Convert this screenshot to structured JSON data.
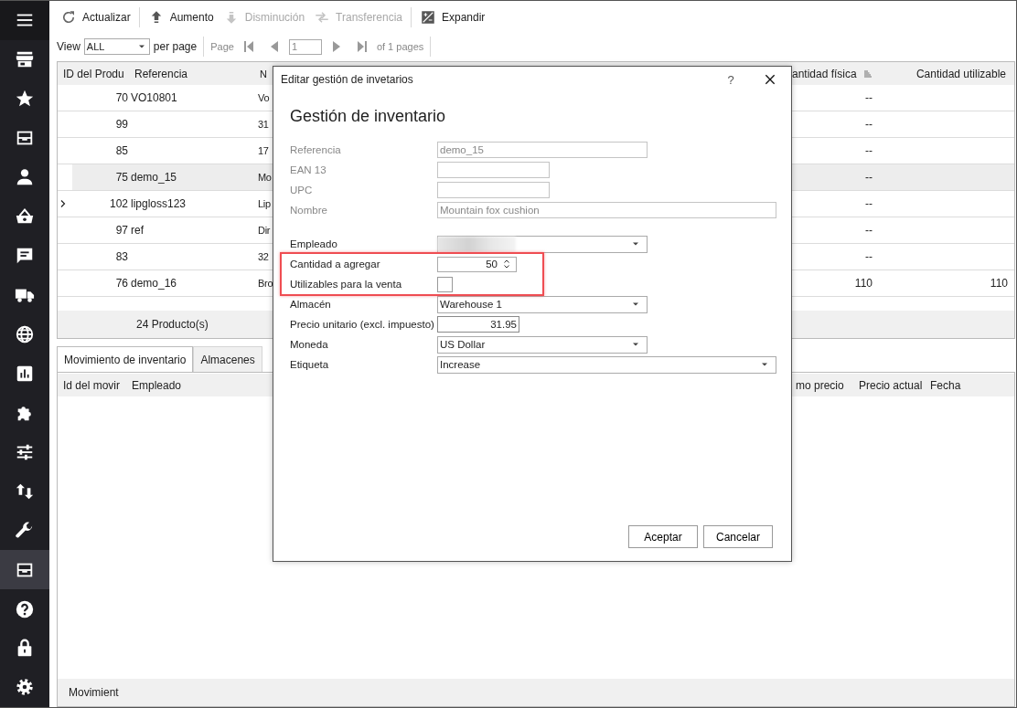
{
  "sidebar": {
    "items": [
      {
        "kind": "menu",
        "selected": false
      },
      {
        "kind": "store",
        "selected": false
      },
      {
        "kind": "star",
        "selected": false
      },
      {
        "kind": "archive",
        "selected": false
      },
      {
        "kind": "user",
        "selected": false
      },
      {
        "kind": "basket",
        "selected": false
      },
      {
        "kind": "chat",
        "selected": false
      },
      {
        "kind": "truck",
        "selected": false
      },
      {
        "kind": "globe",
        "selected": false
      },
      {
        "kind": "chart",
        "selected": false
      },
      {
        "kind": "puzzle",
        "selected": false
      },
      {
        "kind": "sliders",
        "selected": false
      },
      {
        "kind": "swap",
        "selected": false
      },
      {
        "kind": "wrench",
        "selected": false
      },
      {
        "kind": "archive",
        "selected": true
      },
      {
        "kind": "help",
        "selected": false
      },
      {
        "kind": "lock",
        "selected": false
      },
      {
        "kind": "gear",
        "selected": false
      }
    ]
  },
  "toolbar": {
    "buttons": [
      {
        "kind": "refresh",
        "label": "Actualizar",
        "disabled": false
      },
      {
        "kind": "up",
        "label": "Aumento",
        "disabled": false
      },
      {
        "kind": "down",
        "label": "Disminución",
        "disabled": true
      },
      {
        "kind": "transfer",
        "label": "Transferencia",
        "disabled": true
      },
      {
        "kind": "expand",
        "label": "Expandir",
        "disabled": false
      }
    ]
  },
  "pager": {
    "view_label": "View",
    "per_page_value": "ALL",
    "per_page_label": "per page",
    "page_label": "Page",
    "page_value": "1",
    "total_label": "of 1 pages"
  },
  "products_table": {
    "columns": [
      "ID del Produ",
      "Referencia",
      "N",
      "antidad física",
      "Cantidad utilizable"
    ],
    "rows": [
      {
        "id": "70",
        "reference": "VO10801",
        "column_3": "Vo",
        "physical": "--",
        "usable": "",
        "selected": false,
        "current": false
      },
      {
        "id": "99",
        "reference": "",
        "column_3": "31",
        "physical": "--",
        "usable": "",
        "selected": false,
        "current": false
      },
      {
        "id": "85",
        "reference": "",
        "column_3": "17",
        "physical": "--",
        "usable": "",
        "selected": false,
        "current": false
      },
      {
        "id": "75",
        "reference": "demo_15",
        "column_3": "Mo",
        "physical": "--",
        "usable": "",
        "selected": true,
        "current": false
      },
      {
        "id": "102",
        "reference": "lipgloss123",
        "column_3": "Lip",
        "physical": "--",
        "usable": "",
        "selected": false,
        "current": true
      },
      {
        "id": "97",
        "reference": "ref",
        "column_3": "Dir",
        "physical": "--",
        "usable": "",
        "selected": false,
        "current": false
      },
      {
        "id": "83",
        "reference": "",
        "column_3": "32",
        "physical": "--",
        "usable": "",
        "selected": false,
        "current": false
      },
      {
        "id": "76",
        "reference": "demo_16",
        "column_3": "Bro",
        "physical": "110",
        "usable": "110",
        "selected": false,
        "current": false
      }
    ],
    "summary": "24 Producto(s)"
  },
  "tabs": [
    {
      "label": "Movimiento de inventario",
      "selected": true
    },
    {
      "label": "Almacenes",
      "selected": false
    }
  ],
  "movements_table": {
    "columns": [
      "Id del movir",
      "Empleado",
      "mo precio",
      "Precio actual",
      "Fecha"
    ],
    "footer": "Movimient"
  },
  "dialog": {
    "title": "Editar gestión de invetarios",
    "help": "?",
    "heading": "Gestión de inventario",
    "product_fields": [
      {
        "kind": "text",
        "label": "Referencia",
        "value": "demo_15",
        "disabled": true
      },
      {
        "kind": "text",
        "label": "EAN 13",
        "disabled": true
      },
      {
        "kind": "text",
        "label": "UPC",
        "disabled": true
      },
      {
        "kind": "text",
        "label": "Nombre",
        "value": "Mountain fox cushion",
        "disabled": true
      }
    ],
    "movement_fields": [
      {
        "kind": "select",
        "label": "Empleado",
        "value_blurred": true,
        "highlighted": false
      },
      {
        "kind": "spin",
        "label": "Cantidad a agregar",
        "value": "50",
        "highlighted": true
      },
      {
        "kind": "checkbox",
        "label": "Utilizables para la venta",
        "checked": false,
        "highlighted": true
      },
      {
        "kind": "select",
        "label": "Almacén",
        "value": "Warehouse 1",
        "highlighted": false
      },
      {
        "kind": "number",
        "label": "Precio unitario (excl. impuesto)",
        "value": "31.95",
        "highlighted": false
      },
      {
        "kind": "select",
        "label": "Moneda",
        "value": "US Dollar",
        "highlighted": false
      },
      {
        "kind": "select",
        "label": "Etiqueta",
        "value": "Increase",
        "highlighted": false
      }
    ],
    "buttons": [
      "Aceptar",
      "Cancelar"
    ]
  }
}
